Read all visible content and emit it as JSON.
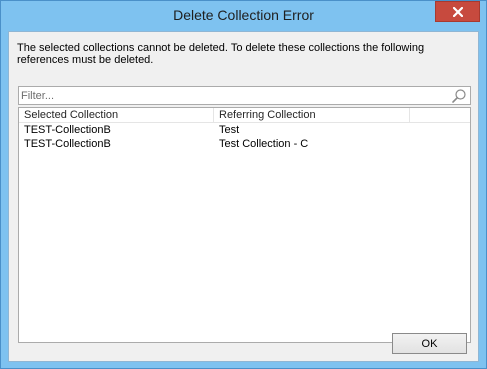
{
  "window": {
    "title": "Delete Collection Error",
    "close_icon": "close-icon"
  },
  "message": "The selected collections cannot be deleted. To delete these collections the following references must be deleted.",
  "filter": {
    "placeholder": "Filter...",
    "value": "",
    "icon": "search-icon"
  },
  "table": {
    "columns": [
      "Selected Collection",
      "Referring Collection",
      ""
    ],
    "rows": [
      {
        "selected": "TEST-CollectionB",
        "referring": "Test"
      },
      {
        "selected": "TEST-CollectionB",
        "referring": "Test Collection - C"
      }
    ]
  },
  "buttons": {
    "ok_label": "OK"
  },
  "colors": {
    "title_bar": "#7ec2f0",
    "close_button": "#c74a3e",
    "dialog_body": "#f0f0f0"
  }
}
